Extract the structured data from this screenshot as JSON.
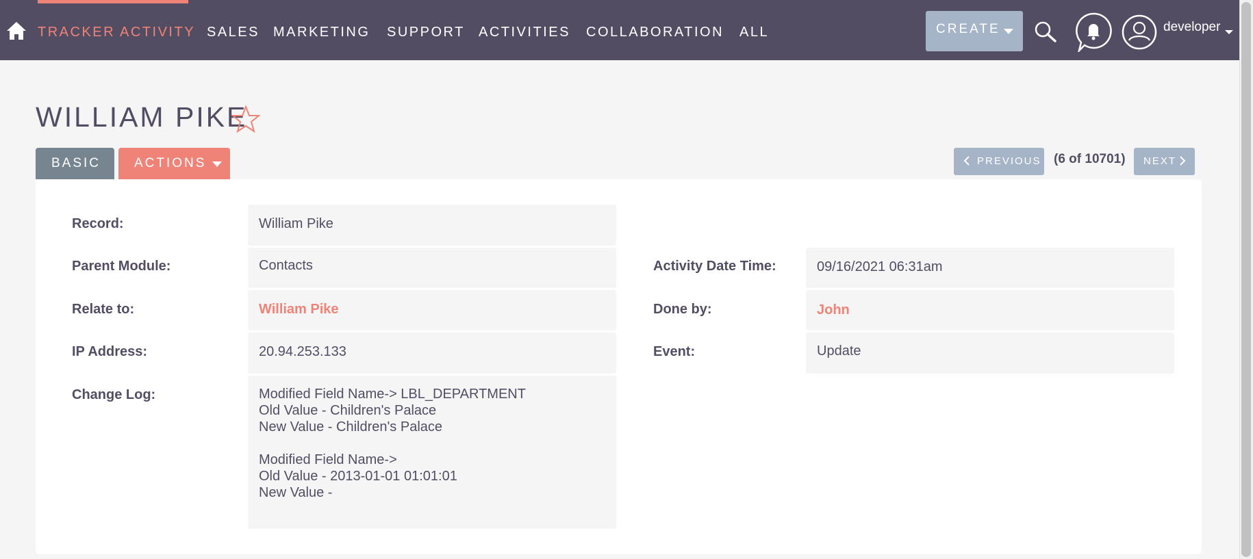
{
  "nav": {
    "items": [
      "TRACKER ACTIVITY",
      "SALES",
      "MARKETING",
      "SUPPORT",
      "ACTIVITIES",
      "COLLABORATION",
      "ALL"
    ],
    "active_index": 0,
    "create_label": "CREATE",
    "user_name": "developer",
    "icons": [
      "home-icon",
      "search-icon",
      "bell-icon",
      "user-icon"
    ]
  },
  "page": {
    "title": "WILLIAM PIKE"
  },
  "tabs": {
    "basic": "BASIC",
    "actions": "ACTIONS"
  },
  "pagination": {
    "previous": "PREVIOUS",
    "count": "(6 of 10701)",
    "next": "NEXT"
  },
  "fields": {
    "record_label": "Record:",
    "record_value": "William Pike",
    "parent_module_label": "Parent Module:",
    "parent_module_value": "Contacts",
    "relate_to_label": "Relate to:",
    "relate_to_value": "William Pike",
    "ip_address_label": "IP Address:",
    "ip_address_value": "20.94.253.133",
    "change_log_label": "Change Log:",
    "change_log_value": "Modified Field Name-> LBL_DEPARTMENT\nOld Value - Children's Palace\nNew Value - Children's Palace\n\nModified Field Name->\nOld Value - 2013-01-01 01:01:01\nNew Value -",
    "activity_date_time_label": "Activity Date Time:",
    "activity_date_time_value": "09/16/2021 06:31am",
    "done_by_label": "Done by:",
    "done_by_value": "John",
    "event_label": "Event:",
    "event_value": "Update"
  },
  "colors": {
    "topbar": "#534d64",
    "accent": "#f08377",
    "button_blue": "#a5b4c6",
    "tab_basic": "#778591"
  }
}
